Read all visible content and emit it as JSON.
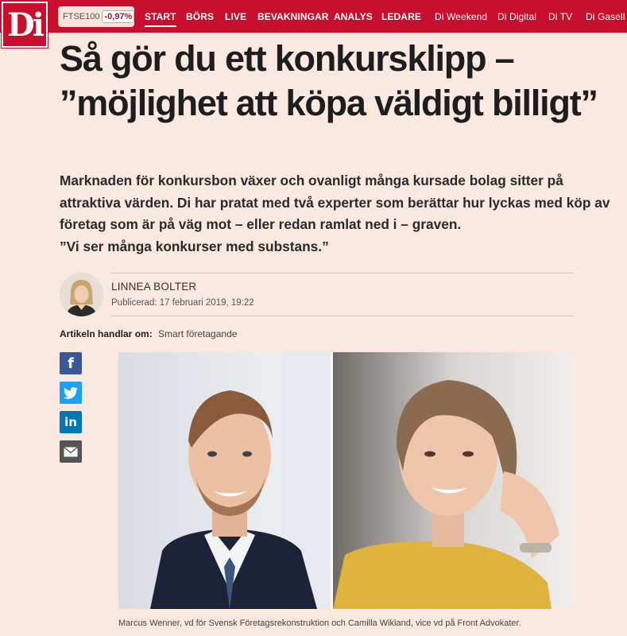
{
  "logo": {
    "text": "Di"
  },
  "ticker": {
    "name": "FTSE100",
    "change": "-0,97%"
  },
  "nav": {
    "items": [
      {
        "label": "START"
      },
      {
        "label": "BÖRS"
      },
      {
        "label": "LIVE"
      },
      {
        "label": "BEVAKNINGAR"
      },
      {
        "label": "ANALYS"
      },
      {
        "label": "LEDARE"
      },
      {
        "label": "Di Weekend"
      },
      {
        "label": "Di Digital"
      },
      {
        "label": "Di TV"
      },
      {
        "label": "Di Gasell"
      }
    ]
  },
  "article": {
    "headline": "Så gör du ett konkursklipp – ”möjlighet att köpa väldigt billigt”",
    "lead_1": "Marknaden för konkursbon växer och ovanligt många kursade bolag sitter på attraktiva värden. Di har pratat med två experter som berättar hur lyckas med köp av företag som är på väg mot – eller redan ramlat ned i – graven.",
    "lead_2": "”Vi ser många konkurser med substans.”",
    "author": "LINNEA BOLTER",
    "published": "Publicerad: 17 februari 2019, 19:22",
    "topics_label": "Artikeln handlar om:",
    "topics_value": "Smart företagande",
    "caption": "Marcus Wenner, vd för Svensk Företagsrekonstruktion och Camilla Wikland, vice vd på Front Advokater."
  },
  "share": {
    "facebook": "f",
    "twitter": "twitter-bird",
    "linkedin": "in",
    "email": "envelope"
  },
  "colors": {
    "brand": "#c8102e",
    "background": "#f9e9e1"
  }
}
